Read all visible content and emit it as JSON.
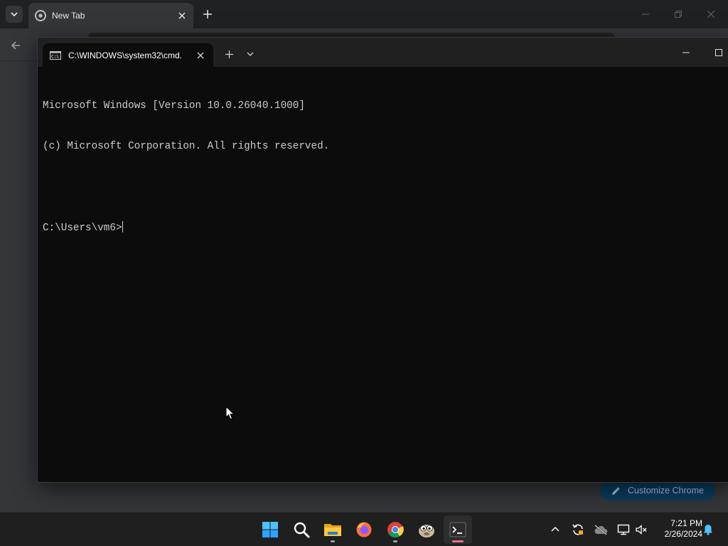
{
  "chrome": {
    "tab_title": "New Tab",
    "customize_label": "Customize Chrome"
  },
  "terminal": {
    "tab_title": "C:\\WINDOWS\\system32\\cmd.",
    "lines": [
      "Microsoft Windows [Version 10.0.26040.1000]",
      "(c) Microsoft Corporation. All rights reserved.",
      "",
      "C:\\Users\\vm6>"
    ]
  },
  "taskbar": {
    "apps": [
      {
        "name": "start-button",
        "icon": "windows-logo-icon"
      },
      {
        "name": "search-button",
        "icon": "search-icon"
      },
      {
        "name": "file-explorer-button",
        "icon": "folder-icon"
      },
      {
        "name": "firefox-button",
        "icon": "firefox-icon"
      },
      {
        "name": "chrome-button",
        "icon": "chrome-icon"
      },
      {
        "name": "app-button",
        "icon": "creature-icon"
      },
      {
        "name": "terminal-button",
        "icon": "terminal-icon"
      }
    ],
    "time": "7:21 PM",
    "date": "2/26/2024"
  },
  "colors": {
    "accent": "#0b3d5e",
    "terminal_bg": "#0c0c0c",
    "taskbar_bg": "#1f1f1f"
  }
}
